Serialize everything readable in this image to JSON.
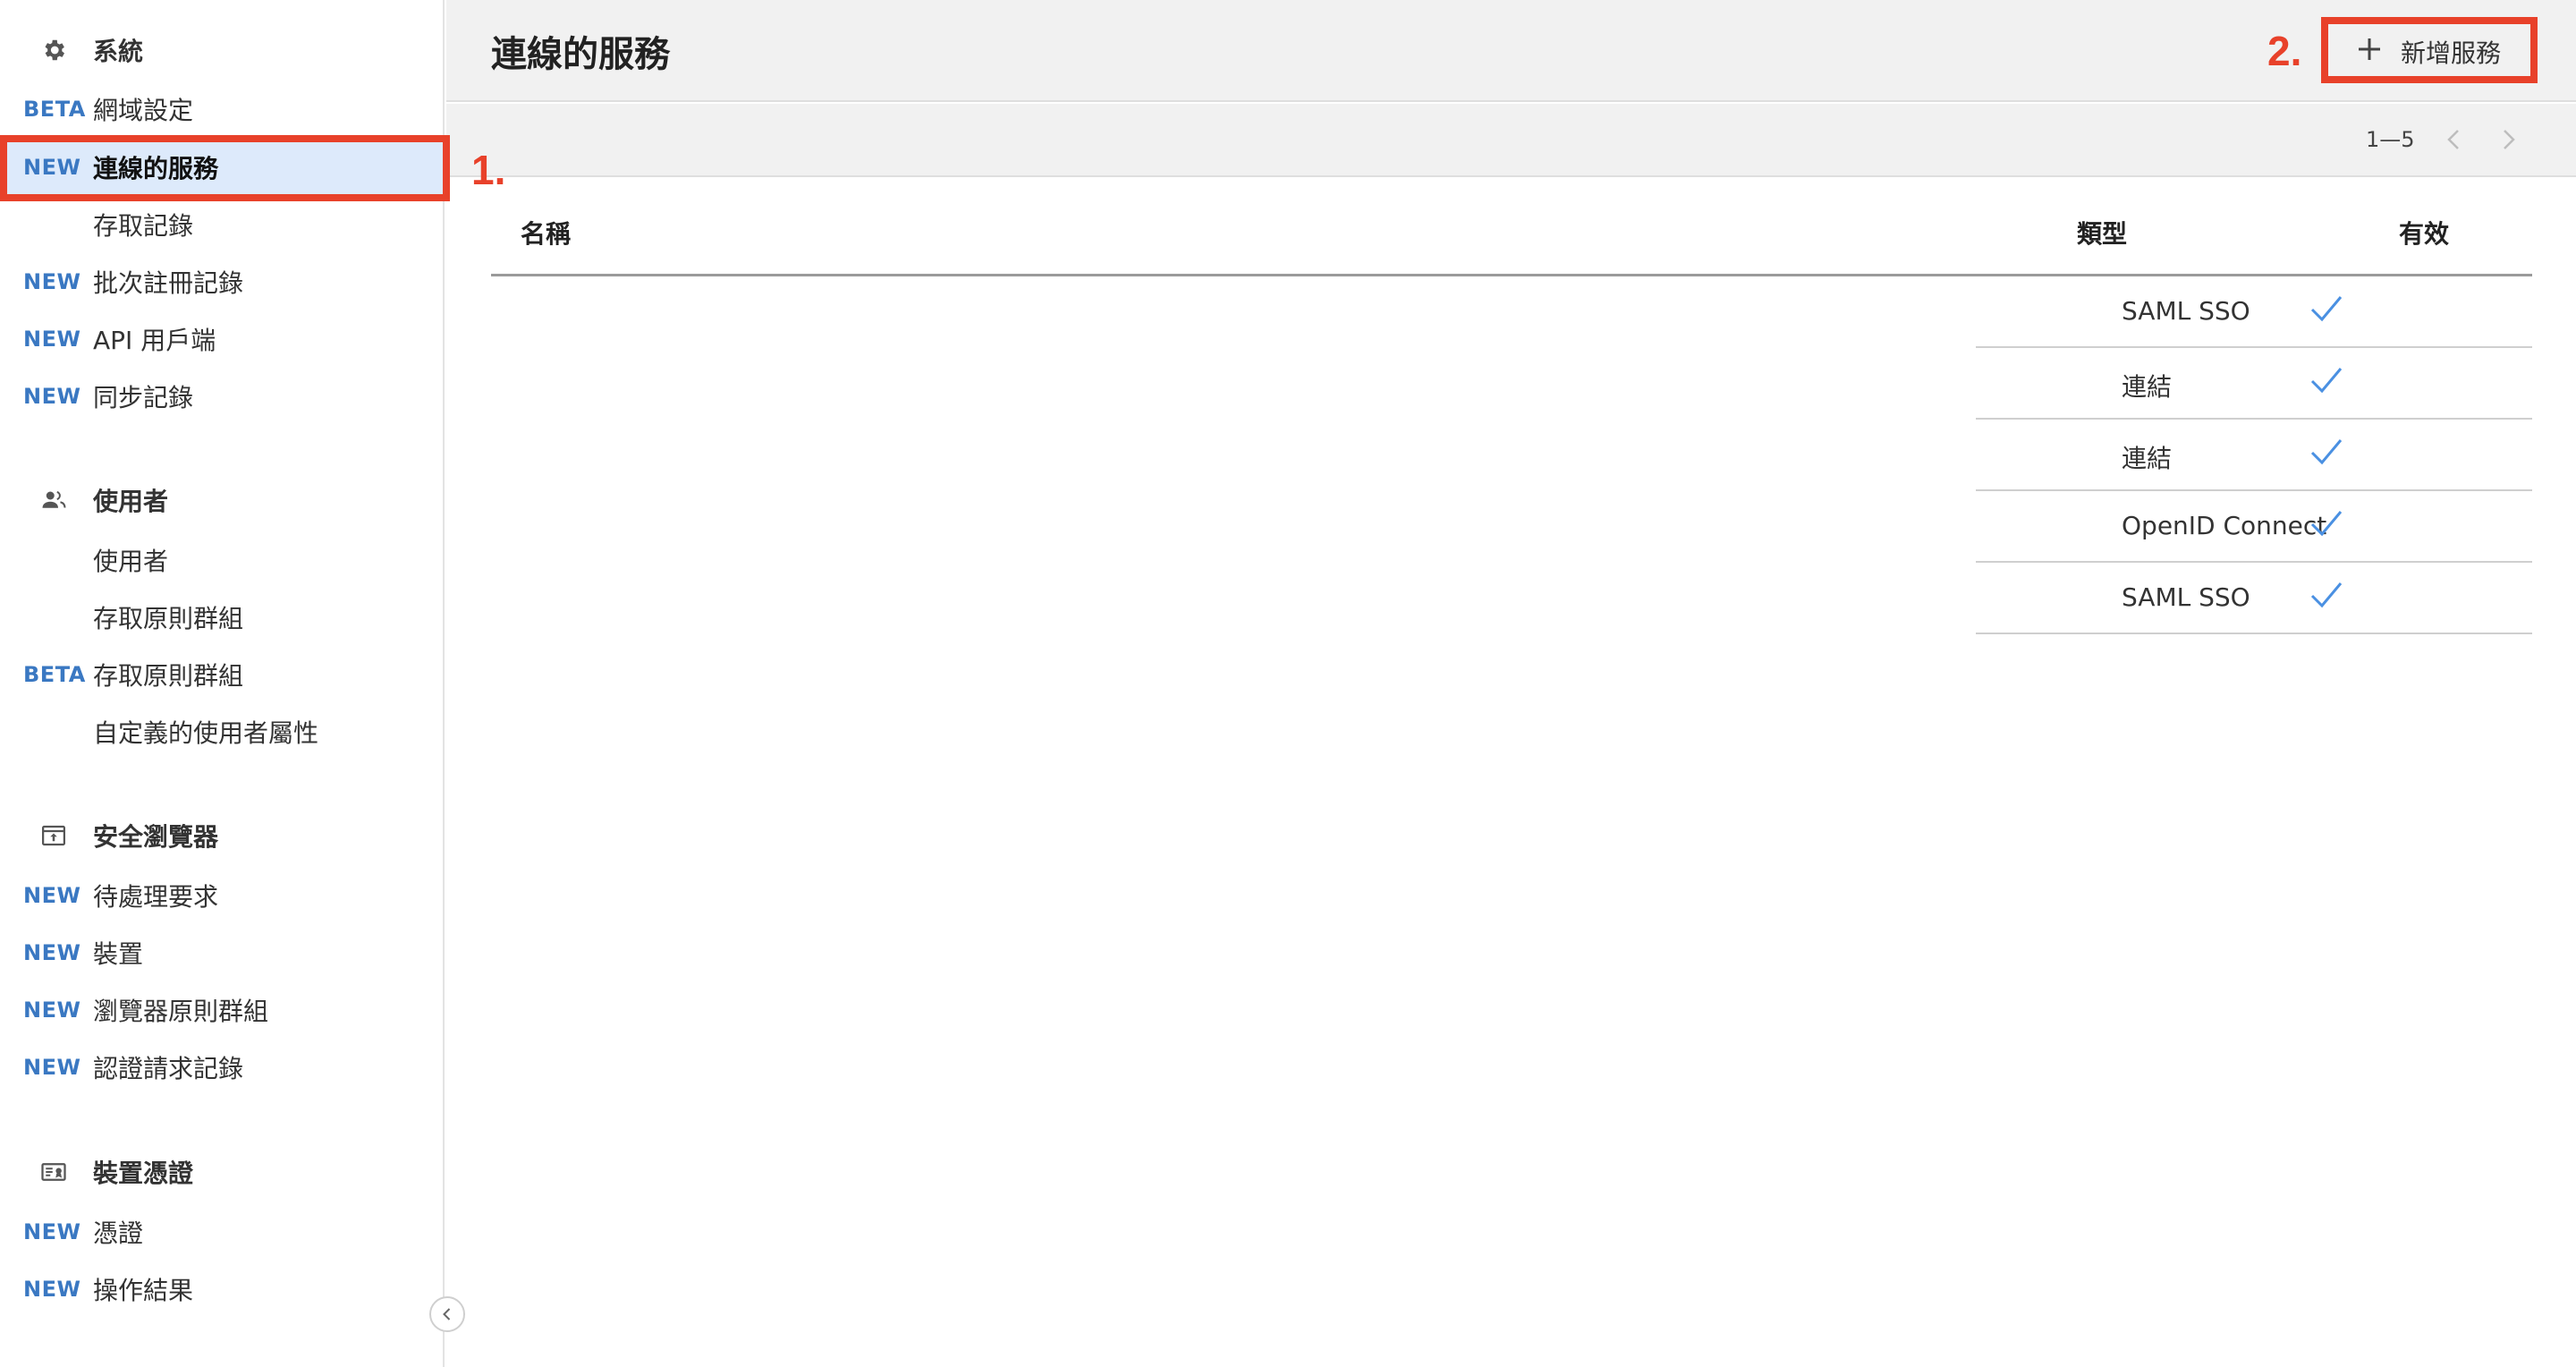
{
  "sidebar": {
    "sections": [
      {
        "title": "系統",
        "icon": "gear-icon",
        "items": [
          {
            "badge": "BETA",
            "label": "網域設定"
          },
          {
            "badge": "NEW",
            "label": "連線的服務",
            "active": true
          },
          {
            "badge": "",
            "label": "存取記錄"
          },
          {
            "badge": "NEW",
            "label": "批次註冊記錄"
          },
          {
            "badge": "NEW",
            "label": "API 用戶端"
          },
          {
            "badge": "NEW",
            "label": "同步記錄"
          }
        ]
      },
      {
        "title": "使用者",
        "icon": "users-icon",
        "items": [
          {
            "badge": "",
            "label": "使用者"
          },
          {
            "badge": "",
            "label": "存取原則群組"
          },
          {
            "badge": "BETA",
            "label": "存取原則群組"
          },
          {
            "badge": "",
            "label": "自定義的使用者屬性"
          }
        ]
      },
      {
        "title": "安全瀏覽器",
        "icon": "secure-browser-icon",
        "items": [
          {
            "badge": "NEW",
            "label": "待處理要求"
          },
          {
            "badge": "NEW",
            "label": "裝置"
          },
          {
            "badge": "NEW",
            "label": "瀏覽器原則群組"
          },
          {
            "badge": "NEW",
            "label": "認證請求記錄"
          }
        ]
      },
      {
        "title": "裝置憑證",
        "icon": "device-certificate-icon",
        "items": [
          {
            "badge": "NEW",
            "label": "憑證"
          },
          {
            "badge": "NEW",
            "label": "操作結果"
          }
        ]
      }
    ]
  },
  "header": {
    "title": "連線的服務",
    "add_button_label": "新增服務"
  },
  "pager": {
    "range": "1—5"
  },
  "table": {
    "columns": {
      "name": "名稱",
      "type": "類型",
      "enabled": "有效"
    },
    "rows": [
      {
        "name": "",
        "type": "SAML SSO",
        "enabled": true
      },
      {
        "name": "",
        "type": "連結",
        "enabled": true
      },
      {
        "name": "",
        "type": "連結",
        "enabled": true
      },
      {
        "name": "",
        "type": "OpenID Connect",
        "enabled": true
      },
      {
        "name": "",
        "type": "SAML SSO",
        "enabled": true
      }
    ]
  },
  "annotations": {
    "step1": "1.",
    "step2": "2."
  },
  "colors": {
    "badge": "#3a78c2",
    "active_bg": "#ddeafb",
    "annotation": "#e8412a",
    "check": "#4a90e2"
  }
}
